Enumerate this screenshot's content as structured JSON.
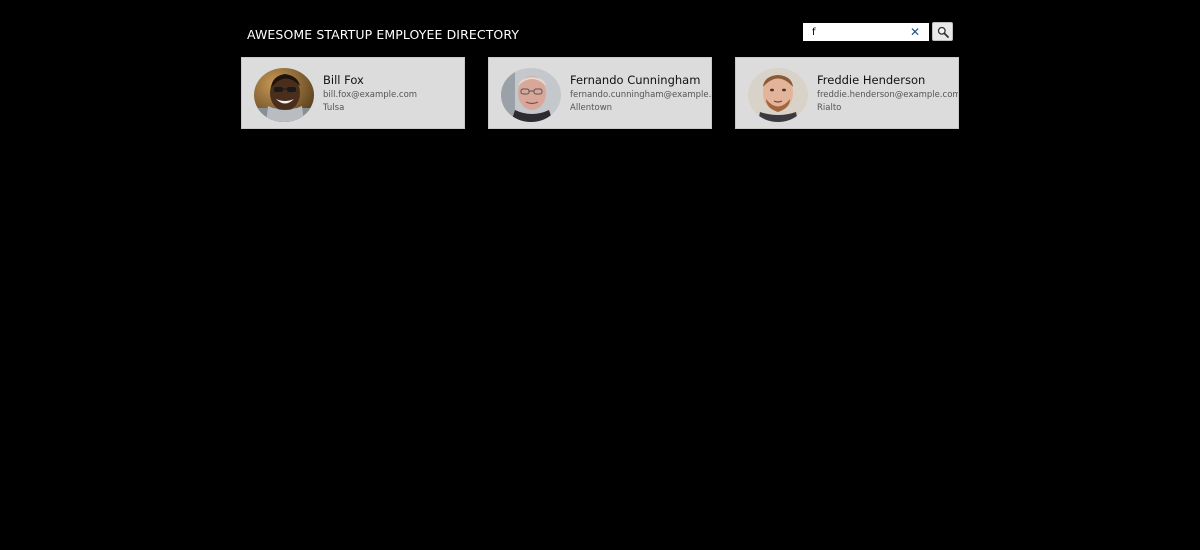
{
  "header": {
    "title": "AWESOME STARTUP EMPLOYEE DIRECTORY"
  },
  "search": {
    "value": "f",
    "clear_icon": "close-icon",
    "button_icon": "search-icon"
  },
  "employees": [
    {
      "name": "Bill Fox",
      "email": "bill.fox@example.com",
      "city": "Tulsa",
      "avatar_icon": "avatar-photo"
    },
    {
      "name": "Fernando Cunningham",
      "email": "fernando.cunningham@example.com",
      "city": "Allentown",
      "avatar_icon": "avatar-photo"
    },
    {
      "name": "Freddie Henderson",
      "email": "freddie.henderson@example.com",
      "city": "Rialto",
      "avatar_icon": "avatar-photo"
    }
  ],
  "colors": {
    "background": "#000000",
    "card": "#dcdcdc",
    "title": "#ffffff",
    "clear_icon": "#1f4e8c"
  }
}
